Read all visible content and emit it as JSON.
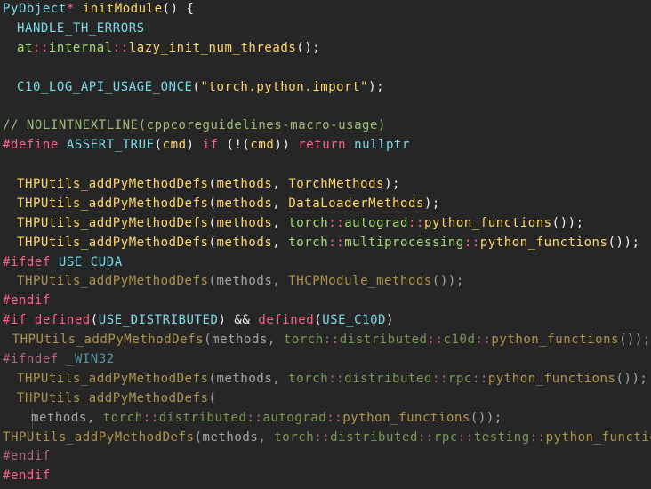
{
  "editor": {
    "colors": {
      "background": "#262626",
      "text": "#f2f2f2",
      "function": "#ffd866",
      "macro": "#78dce8",
      "keyword": "#ff6188",
      "string": "#ffd866",
      "namespace": "#a9dc76",
      "comment": "#9dbd7a"
    },
    "lines": [
      {
        "indent": 0,
        "dim": false,
        "tokens": [
          {
            "t": "PyObject",
            "c": "type"
          },
          {
            "t": "* ",
            "c": "keyword"
          },
          {
            "t": "initModule",
            "c": "func"
          },
          {
            "t": "() {",
            "c": "punct"
          }
        ]
      },
      {
        "indent": 1,
        "dim": false,
        "tokens": [
          {
            "t": "HANDLE_TH_ERRORS",
            "c": "macro"
          }
        ]
      },
      {
        "indent": 1,
        "dim": false,
        "tokens": [
          {
            "t": "at",
            "c": "ns"
          },
          {
            "t": "::",
            "c": "keyword"
          },
          {
            "t": "internal",
            "c": "ns"
          },
          {
            "t": "::",
            "c": "keyword"
          },
          {
            "t": "lazy_init_num_threads",
            "c": "func"
          },
          {
            "t": "();",
            "c": "punct"
          }
        ]
      },
      {
        "indent": 0,
        "dim": false,
        "tokens": []
      },
      {
        "indent": 1,
        "dim": false,
        "tokens": [
          {
            "t": "C10_LOG_API_USAGE_ONCE",
            "c": "macro"
          },
          {
            "t": "(",
            "c": "punct"
          },
          {
            "t": "\"torch.python.import\"",
            "c": "string"
          },
          {
            "t": ");",
            "c": "punct"
          }
        ]
      },
      {
        "indent": 0,
        "dim": false,
        "tokens": []
      },
      {
        "indent": 0,
        "dim": false,
        "tokens": [
          {
            "t": "// NOLINTNEXTLINE(cppcoreguidelines-macro-usage)",
            "c": "comment"
          }
        ]
      },
      {
        "indent": 0,
        "dim": false,
        "tokens": [
          {
            "t": "#define",
            "c": "keyword"
          },
          {
            "t": " ",
            "c": "punct"
          },
          {
            "t": "ASSERT_TRUE",
            "c": "macro"
          },
          {
            "t": "(",
            "c": "punct"
          },
          {
            "t": "cmd",
            "c": "func"
          },
          {
            "t": ") ",
            "c": "punct"
          },
          {
            "t": "if",
            "c": "keyword"
          },
          {
            "t": " (!(",
            "c": "punct"
          },
          {
            "t": "cmd",
            "c": "func"
          },
          {
            "t": ")) ",
            "c": "punct"
          },
          {
            "t": "return",
            "c": "keyword"
          },
          {
            "t": " ",
            "c": "punct"
          },
          {
            "t": "nullptr",
            "c": "macro"
          }
        ]
      },
      {
        "indent": 0,
        "dim": false,
        "tokens": []
      },
      {
        "indent": 1,
        "dim": false,
        "tokens": [
          {
            "t": "THPUtils_addPyMethodDefs",
            "c": "func"
          },
          {
            "t": "(",
            "c": "punct"
          },
          {
            "t": "methods",
            "c": "func"
          },
          {
            "t": ", ",
            "c": "punct"
          },
          {
            "t": "TorchMethods",
            "c": "func"
          },
          {
            "t": ");",
            "c": "punct"
          }
        ]
      },
      {
        "indent": 1,
        "dim": false,
        "tokens": [
          {
            "t": "THPUtils_addPyMethodDefs",
            "c": "func"
          },
          {
            "t": "(",
            "c": "punct"
          },
          {
            "t": "methods",
            "c": "func"
          },
          {
            "t": ", ",
            "c": "punct"
          },
          {
            "t": "DataLoaderMethods",
            "c": "func"
          },
          {
            "t": ");",
            "c": "punct"
          }
        ]
      },
      {
        "indent": 1,
        "dim": false,
        "tokens": [
          {
            "t": "THPUtils_addPyMethodDefs",
            "c": "func"
          },
          {
            "t": "(",
            "c": "punct"
          },
          {
            "t": "methods",
            "c": "func"
          },
          {
            "t": ", ",
            "c": "punct"
          },
          {
            "t": "torch",
            "c": "ns"
          },
          {
            "t": "::",
            "c": "keyword"
          },
          {
            "t": "autograd",
            "c": "ns"
          },
          {
            "t": "::",
            "c": "keyword"
          },
          {
            "t": "python_functions",
            "c": "func"
          },
          {
            "t": "());",
            "c": "punct"
          }
        ]
      },
      {
        "indent": 1,
        "dim": false,
        "tokens": [
          {
            "t": "THPUtils_addPyMethodDefs",
            "c": "func"
          },
          {
            "t": "(",
            "c": "punct"
          },
          {
            "t": "methods",
            "c": "func"
          },
          {
            "t": ", ",
            "c": "punct"
          },
          {
            "t": "torch",
            "c": "ns"
          },
          {
            "t": "::",
            "c": "keyword"
          },
          {
            "t": "multiprocessing",
            "c": "ns"
          },
          {
            "t": "::",
            "c": "keyword"
          },
          {
            "t": "python_functions",
            "c": "func"
          },
          {
            "t": "());",
            "c": "punct"
          }
        ]
      },
      {
        "indent": 0,
        "dim": false,
        "tokens": [
          {
            "t": "#ifdef",
            "c": "keyword"
          },
          {
            "t": " ",
            "c": "punct"
          },
          {
            "t": "USE_CUDA",
            "c": "macro"
          }
        ]
      },
      {
        "indent": 1,
        "dim": true,
        "tokens": [
          {
            "t": "THPUtils_addPyMethodDefs",
            "c": "func"
          },
          {
            "t": "(methods, ",
            "c": "punct"
          },
          {
            "t": "THCPModule_methods",
            "c": "func"
          },
          {
            "t": "());",
            "c": "punct"
          }
        ]
      },
      {
        "indent": 0,
        "dim": false,
        "tokens": [
          {
            "t": "#endif",
            "c": "keyword"
          }
        ]
      },
      {
        "indent": 0,
        "dim": false,
        "tokens": [
          {
            "t": "#if",
            "c": "keyword"
          },
          {
            "t": " ",
            "c": "punct"
          },
          {
            "t": "defined",
            "c": "keyword"
          },
          {
            "t": "(",
            "c": "punct"
          },
          {
            "t": "USE_DISTRIBUTED",
            "c": "macro"
          },
          {
            "t": ") && ",
            "c": "punct"
          },
          {
            "t": "defined",
            "c": "keyword"
          },
          {
            "t": "(",
            "c": "punct"
          },
          {
            "t": "USE_C10D",
            "c": "macro"
          },
          {
            "t": ")",
            "c": "punct"
          }
        ]
      },
      {
        "indent": 1,
        "dim": true,
        "tokens": [
          {
            "t": "THPUtils_addPyMethodDefs",
            "c": "func"
          },
          {
            "t": "(methods, ",
            "c": "punct"
          },
          {
            "t": "torch",
            "c": "ns"
          },
          {
            "t": "::",
            "c": "keyword"
          },
          {
            "t": "distributed",
            "c": "ns"
          },
          {
            "t": "::",
            "c": "keyword"
          },
          {
            "t": "c10d",
            "c": "ns"
          },
          {
            "t": "::",
            "c": "keyword"
          },
          {
            "t": "python_functions",
            "c": "func"
          },
          {
            "t": "());",
            "c": "punct"
          }
        ]
      },
      {
        "indent": 0,
        "dim": true,
        "tokens": [
          {
            "t": "#ifndef",
            "c": "keyword"
          },
          {
            "t": " ",
            "c": "punct"
          },
          {
            "t": "_WIN32",
            "c": "macro"
          }
        ]
      },
      {
        "indent": 1,
        "dim": true,
        "tokens": [
          {
            "t": "THPUtils_addPyMethodDefs",
            "c": "func"
          },
          {
            "t": "(methods, ",
            "c": "punct"
          },
          {
            "t": "torch",
            "c": "ns"
          },
          {
            "t": "::",
            "c": "keyword"
          },
          {
            "t": "distributed",
            "c": "ns"
          },
          {
            "t": "::",
            "c": "keyword"
          },
          {
            "t": "rpc",
            "c": "ns"
          },
          {
            "t": "::",
            "c": "keyword"
          },
          {
            "t": "python_functions",
            "c": "func"
          },
          {
            "t": "());",
            "c": "punct"
          }
        ]
      },
      {
        "indent": 1,
        "dim": true,
        "tokens": [
          {
            "t": "THPUtils_addPyMethodDefs",
            "c": "func"
          },
          {
            "t": "(",
            "c": "punct"
          }
        ]
      },
      {
        "indent": 2,
        "dim": true,
        "guide": true,
        "tokens": [
          {
            "t": "methods, ",
            "c": "punct"
          },
          {
            "t": "torch",
            "c": "ns"
          },
          {
            "t": "::",
            "c": "keyword"
          },
          {
            "t": "distributed",
            "c": "ns"
          },
          {
            "t": "::",
            "c": "keyword"
          },
          {
            "t": "autograd",
            "c": "ns"
          },
          {
            "t": "::",
            "c": "keyword"
          },
          {
            "t": "python_functions",
            "c": "func"
          },
          {
            "t": "());",
            "c": "punct"
          }
        ]
      },
      {
        "indent": 1,
        "dim": true,
        "tokens": [
          {
            "t": "THPUtils_addPyMethodDefs",
            "c": "func"
          },
          {
            "t": "(methods, ",
            "c": "punct"
          },
          {
            "t": "torch",
            "c": "ns"
          },
          {
            "t": "::",
            "c": "keyword"
          },
          {
            "t": "distributed",
            "c": "ns"
          },
          {
            "t": "::",
            "c": "keyword"
          },
          {
            "t": "rpc",
            "c": "ns"
          },
          {
            "t": "::",
            "c": "keyword"
          },
          {
            "t": "testing",
            "c": "ns"
          },
          {
            "t": "::",
            "c": "keyword"
          },
          {
            "t": "python_functions",
            "c": "func"
          },
          {
            "t": "());",
            "c": "punct"
          }
        ]
      },
      {
        "indent": 0,
        "dim": true,
        "tokens": [
          {
            "t": "#endif",
            "c": "keyword"
          }
        ]
      },
      {
        "indent": 0,
        "dim": false,
        "tokens": [
          {
            "t": "#endif",
            "c": "keyword"
          }
        ]
      }
    ]
  }
}
